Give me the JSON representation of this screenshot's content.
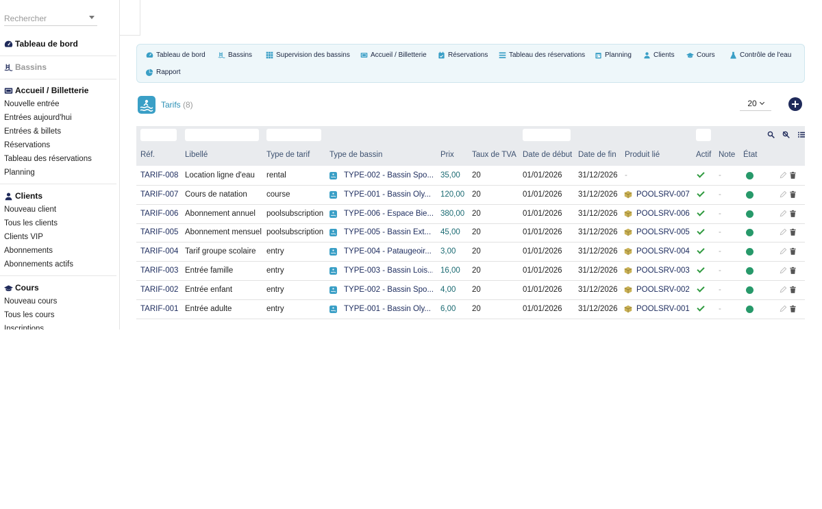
{
  "search": {
    "placeholder": "Rechercher"
  },
  "sidebar": {
    "sections": [
      {
        "title": "Tableau de bord",
        "icon": "dashboard-icon",
        "items": []
      },
      {
        "title": "Bassins",
        "icon": "pool-icon",
        "disabled": true,
        "items": []
      },
      {
        "title": "Accueil / Billetterie",
        "icon": "ticket-icon",
        "items": [
          "Nouvelle entrée",
          "Entrées aujourd'hui",
          "Entrées & billets",
          "Réservations",
          "Tableau des réservations",
          "Planning"
        ]
      },
      {
        "title": "Clients",
        "icon": "user-icon",
        "items": [
          "Nouveau client",
          "Tous les clients",
          "Clients VIP",
          "Abonnements",
          "Abonnements actifs"
        ]
      },
      {
        "title": "Cours",
        "icon": "graduation-cap-icon",
        "items": [
          "Nouveau cours",
          "Tous les cours",
          "Inscriptions"
        ]
      }
    ]
  },
  "topnav": [
    {
      "label": "Tableau de bord",
      "icon": "dashboard-icon"
    },
    {
      "label": "Bassins",
      "icon": "pool-icon"
    },
    {
      "label": "Supervision des bassins",
      "icon": "grid-icon"
    },
    {
      "label": "Accueil / Billetterie",
      "icon": "ticket-icon"
    },
    {
      "label": "Réservations",
      "icon": "calendar-check-icon"
    },
    {
      "label": "Tableau des réservations",
      "icon": "list-icon"
    },
    {
      "label": "Planning",
      "icon": "calendar-icon"
    },
    {
      "label": "Clients",
      "icon": "user-icon"
    },
    {
      "label": "Cours",
      "icon": "graduation-cap-icon"
    },
    {
      "label": "Contrôle de l'eau",
      "icon": "flask-icon"
    },
    {
      "label": "Rapport",
      "icon": "pie-chart-icon"
    }
  ],
  "page": {
    "title": "Tarifs",
    "count": "(8)",
    "per_page": "20"
  },
  "table": {
    "columns": [
      "Réf.",
      "Libellé",
      "Type de tarif",
      "Type de bassin",
      "Prix",
      "Taux de TVA",
      "Date de début",
      "Date de fin",
      "Produit lié",
      "Actif",
      "Note",
      "État"
    ],
    "rows": [
      {
        "ref": "TARIF-008",
        "label": "Location ligne d'eau",
        "tariff_type": "rental",
        "pool_type": "TYPE-002 - Bassin Spo...",
        "price": "35,00",
        "vat": "20",
        "start": "01/01/2026",
        "end": "31/12/2026",
        "product": "-",
        "note": "-"
      },
      {
        "ref": "TARIF-007",
        "label": "Cours de natation",
        "tariff_type": "course",
        "pool_type": "TYPE-001 - Bassin Oly...",
        "price": "120,00",
        "vat": "20",
        "start": "01/01/2026",
        "end": "31/12/2026",
        "product": "POOLSRV-007",
        "note": "-"
      },
      {
        "ref": "TARIF-006",
        "label": "Abonnement annuel",
        "tariff_type": "poolsubscription",
        "pool_type": "TYPE-006 - Espace Bie...",
        "price": "380,00",
        "vat": "20",
        "start": "01/01/2026",
        "end": "31/12/2026",
        "product": "POOLSRV-006",
        "note": "-"
      },
      {
        "ref": "TARIF-005",
        "label": "Abonnement mensuel",
        "tariff_type": "poolsubscription",
        "pool_type": "TYPE-005 - Bassin Ext...",
        "price": "45,00",
        "vat": "20",
        "start": "01/01/2026",
        "end": "31/12/2026",
        "product": "POOLSRV-005",
        "note": "-"
      },
      {
        "ref": "TARIF-004",
        "label": "Tarif groupe scolaire",
        "tariff_type": "entry",
        "pool_type": "TYPE-004 - Pataugeoir...",
        "price": "3,00",
        "vat": "20",
        "start": "01/01/2026",
        "end": "31/12/2026",
        "product": "POOLSRV-004",
        "note": "-"
      },
      {
        "ref": "TARIF-003",
        "label": "Entrée famille",
        "tariff_type": "entry",
        "pool_type": "TYPE-003 - Bassin Lois...",
        "price": "16,00",
        "vat": "20",
        "start": "01/01/2026",
        "end": "31/12/2026",
        "product": "POOLSRV-003",
        "note": "-"
      },
      {
        "ref": "TARIF-002",
        "label": "Entrée enfant",
        "tariff_type": "entry",
        "pool_type": "TYPE-002 - Bassin Spo...",
        "price": "4,00",
        "vat": "20",
        "start": "01/01/2026",
        "end": "31/12/2026",
        "product": "POOLSRV-002",
        "note": "-"
      },
      {
        "ref": "TARIF-001",
        "label": "Entrée adulte",
        "tariff_type": "entry",
        "pool_type": "TYPE-001 - Bassin Oly...",
        "price": "6,00",
        "vat": "20",
        "start": "01/01/2026",
        "end": "31/12/2026",
        "product": "POOLSRV-001",
        "note": "-"
      }
    ]
  },
  "colors": {
    "accent": "#2a8fb5",
    "nav_bg": "#eef7fa",
    "link": "#1d2c5e",
    "status_on": "#27996a",
    "check": "#2f9a3f",
    "product_icon": "#b8a040"
  }
}
